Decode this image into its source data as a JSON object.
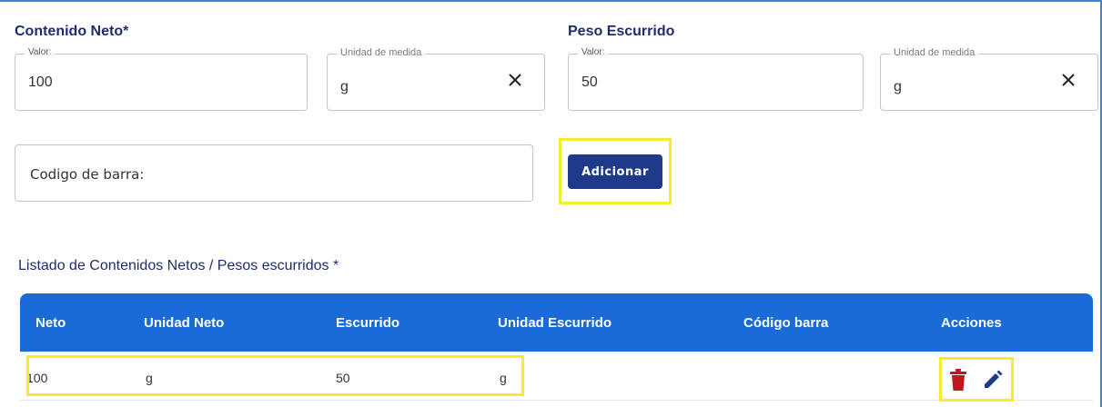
{
  "contenido_neto": {
    "title": "Contenido Neto*",
    "valor_legend": "Valor:",
    "valor": "100",
    "unidad_legend": "Unidad de medida",
    "unidad": "g"
  },
  "peso_escurrido": {
    "title": "Peso Escurrido",
    "valor_legend": "Valor:",
    "valor": "50",
    "unidad_legend": "Unidad de medida",
    "unidad": "g"
  },
  "barcode": {
    "label": "Codigo de barra:"
  },
  "add_button": {
    "label": "Adicionar"
  },
  "list": {
    "title": "Listado de Contenidos Netos / Pesos escurridos *",
    "headers": [
      "Neto",
      "Unidad Neto",
      "Escurrido",
      "Unidad Escurrido",
      "Código barra",
      "Acciones"
    ],
    "rows": [
      {
        "neto": "100",
        "unidad_neto": "g",
        "escurrido": "50",
        "unidad_escurrido": "g",
        "codigo_barra": ""
      }
    ]
  },
  "colors": {
    "primary": "#1f3a8a",
    "header": "#1a6bd6",
    "delete": "#c0161c",
    "edit": "#1f3a8a",
    "highlight": "#f5ec2a"
  },
  "icons": {
    "clear": "close-icon",
    "delete": "trash-icon",
    "edit": "pencil-icon"
  }
}
